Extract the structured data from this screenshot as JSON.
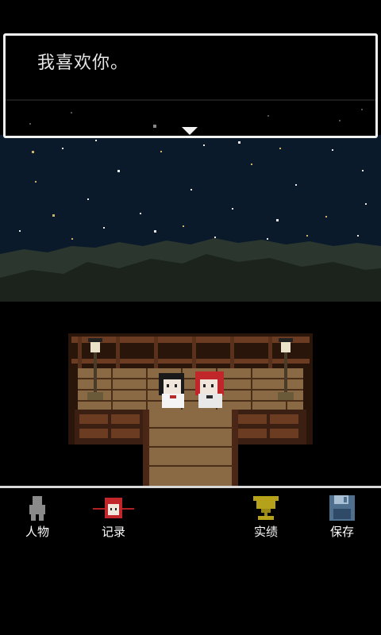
{
  "dialog": {
    "text": "我喜欢你。"
  },
  "menu": {
    "characters_label": "人物",
    "records_label": "记录",
    "achievements_label": "实绩",
    "save_label": "保存"
  },
  "colors": {
    "sky": "#0b1a2a",
    "mountain_far": "#2b362f",
    "mountain_near": "#1c231d",
    "wood_dark": "#3a1f12",
    "wood_mid": "#6b3c22",
    "plank": "#8a6a45",
    "trophy": "#b6a21a",
    "floppy": "#4f6f8f"
  },
  "icons": {
    "characters": "person-silhouette-icon",
    "records": "red-haired-girl-icon",
    "achievements": "trophy-icon",
    "save": "floppy-disk-icon"
  }
}
